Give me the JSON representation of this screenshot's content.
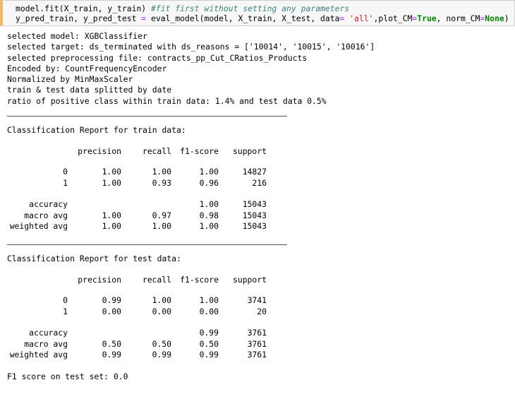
{
  "code_cell": {
    "line1_code": "model.fit(X_train, y_train) ",
    "line1_comment": "#fit first without setting any parameters",
    "line2_a": "y_pred_train, y_pred_test ",
    "line2_eq": "=",
    "line2_b": " eval_model(model, X_train, X_test, data",
    "line2_eq2": "=",
    "line2_c": " ",
    "line2_str": "'all'",
    "line2_d": ",plot_CM",
    "line2_eq3": "=",
    "line2_true": "True",
    "line2_e": ", norm_CM",
    "line2_eq4": "=",
    "line2_none": "None",
    "line2_f": ")"
  },
  "output": {
    "info_lines": [
      "selected model: XGBClassifier",
      "selected target: ds_terminated with ds_reasons = ['10014', '10015', '10016']",
      "selected preprocessing file: contracts_pp_Cut_CRatios_Products",
      "Encoded by: CountFrequencyEncoder",
      "Normalized by MinMaxScaler",
      "train & test data splitted by date",
      "ratio of positive class within train data: 1.4% and test data 0.5%"
    ],
    "train_report": {
      "title": "Classification Report for train data:",
      "headers": [
        "precision",
        "recall",
        "f1-score",
        "support"
      ],
      "rows": [
        {
          "label": "0",
          "precision": "1.00",
          "recall": "1.00",
          "f1": "1.00",
          "support": "14827"
        },
        {
          "label": "1",
          "precision": "1.00",
          "recall": "0.93",
          "f1": "0.96",
          "support": "216"
        }
      ],
      "summary": [
        {
          "label": "accuracy",
          "precision": "",
          "recall": "",
          "f1": "1.00",
          "support": "15043"
        },
        {
          "label": "macro avg",
          "precision": "1.00",
          "recall": "0.97",
          "f1": "0.98",
          "support": "15043"
        },
        {
          "label": "weighted avg",
          "precision": "1.00",
          "recall": "1.00",
          "f1": "1.00",
          "support": "15043"
        }
      ]
    },
    "test_report": {
      "title": "Classification Report for test data:",
      "headers": [
        "precision",
        "recall",
        "f1-score",
        "support"
      ],
      "rows": [
        {
          "label": "0",
          "precision": "0.99",
          "recall": "1.00",
          "f1": "1.00",
          "support": "3741"
        },
        {
          "label": "1",
          "precision": "0.00",
          "recall": "0.00",
          "f1": "0.00",
          "support": "20"
        }
      ],
      "summary": [
        {
          "label": "accuracy",
          "precision": "",
          "recall": "",
          "f1": "0.99",
          "support": "3761"
        },
        {
          "label": "macro avg",
          "precision": "0.50",
          "recall": "0.50",
          "f1": "0.50",
          "support": "3761"
        },
        {
          "label": "weighted avg",
          "precision": "0.99",
          "recall": "0.99",
          "f1": "0.99",
          "support": "3761"
        }
      ]
    },
    "final_line": "F1 score on test set: 0.0"
  }
}
